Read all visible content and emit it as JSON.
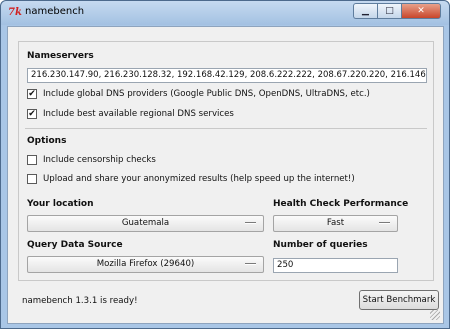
{
  "window": {
    "title": "namebench",
    "icon_glyph": "7k",
    "minimize_glyph": "▁",
    "maximize_glyph": "□",
    "close_glyph": "✕"
  },
  "nameservers": {
    "heading": "Nameservers",
    "value": "216.230.147.90, 216.230.128.32, 192.168.42.129, 208.6.222.222, 208.67.220.220, 216.146.35.35, 2",
    "include_global": {
      "label": "Include global DNS providers (Google Public DNS, OpenDNS, UltraDNS, etc.)",
      "checked": true
    },
    "include_regional": {
      "label": "Include best available regional DNS services",
      "checked": true
    }
  },
  "options": {
    "heading": "Options",
    "censorship": {
      "label": "Include censorship checks",
      "checked": false
    },
    "upload": {
      "label": "Upload and share your anonymized results (help speed up the internet!)",
      "checked": false
    }
  },
  "location": {
    "label": "Your location",
    "value": "Guatemala"
  },
  "health": {
    "label": "Health Check Performance",
    "value": "Fast"
  },
  "query_source": {
    "label": "Query Data Source",
    "value": "Mozilla Firefox (29640)"
  },
  "queries": {
    "label": "Number of queries",
    "value": "250"
  },
  "status_text": "namebench 1.3.1 is ready!",
  "start_button": "Start Benchmark",
  "check_mark": "✔"
}
